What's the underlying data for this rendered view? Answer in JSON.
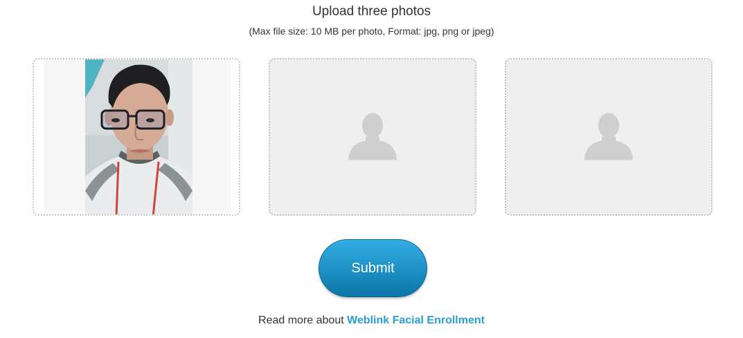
{
  "header": {
    "title": "Upload three photos",
    "subtitle": "(Max file size: 10 MB per photo, Format: jpg, png or jpeg)"
  },
  "photos": [
    {
      "state": "uploaded",
      "description_icon": "user-photo"
    },
    {
      "state": "empty",
      "icon": "user-placeholder-icon"
    },
    {
      "state": "empty",
      "icon": "user-placeholder-icon"
    }
  ],
  "actions": {
    "submit_label": "Submit"
  },
  "footer": {
    "prefix": "Read more about ",
    "link_text": "Weblink Facial Enrollment"
  },
  "colors": {
    "accent": "#2a9fd6",
    "button_top": "#33aee4",
    "button_bottom": "#0b76a7",
    "slot_bg": "#efefef",
    "slot_border": "#c4c4c4",
    "placeholder_icon": "#cfcfcf"
  }
}
